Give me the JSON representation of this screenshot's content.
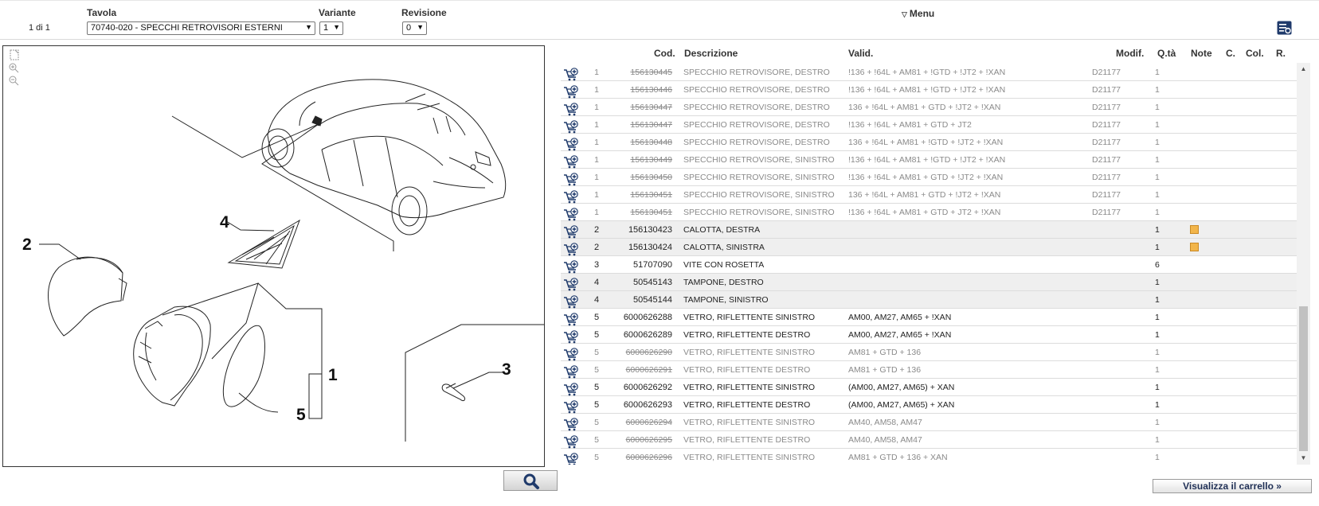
{
  "header": {
    "page_info": "1 di 1",
    "tavola_label": "Tavola",
    "tavola_value": "70740-020 - SPECCHI RETROVISORI ESTERNI",
    "variante_label": "Variante",
    "variante_value": "1",
    "revisione_label": "Revisione",
    "revisione_value": "0",
    "menu_label": "Menu"
  },
  "drawing": {
    "callouts": [
      "1",
      "2",
      "3",
      "4",
      "5"
    ]
  },
  "table": {
    "headers": {
      "cod": "Cod.",
      "descrizione": "Descrizione",
      "valid": "Valid.",
      "modif": "Modif.",
      "qta": "Q.tà",
      "note": "Note",
      "c": "C.",
      "col": "Col.",
      "r": "R."
    },
    "rows": [
      {
        "num": "1",
        "code": "156130445",
        "desc": "SPECCHIO RETROVISORE, DESTRO",
        "valid": "!136 + !64L + AM81 + !GTD + !JT2 + !XAN",
        "modif": "D21177",
        "qty": "1",
        "obsolete": true,
        "shaded": false,
        "note": false
      },
      {
        "num": "1",
        "code": "156130446",
        "desc": "SPECCHIO RETROVISORE, DESTRO",
        "valid": "!136 + !64L + AM81 + !GTD + !JT2 + !XAN",
        "modif": "D21177",
        "qty": "1",
        "obsolete": true,
        "shaded": false,
        "note": false
      },
      {
        "num": "1",
        "code": "156130447",
        "desc": "SPECCHIO RETROVISORE, DESTRO",
        "valid": "136 + !64L + AM81 + GTD + !JT2 + !XAN",
        "modif": "D21177",
        "qty": "1",
        "obsolete": true,
        "shaded": false,
        "note": false
      },
      {
        "num": "1",
        "code": "156130447",
        "desc": "SPECCHIO RETROVISORE, DESTRO",
        "valid": "!136 + !64L + AM81 + GTD + JT2",
        "modif": "D21177",
        "qty": "1",
        "obsolete": true,
        "shaded": false,
        "note": false
      },
      {
        "num": "1",
        "code": "156130448",
        "desc": "SPECCHIO RETROVISORE, DESTRO",
        "valid": "136 + !64L + AM81 + !GTD + !JT2 + !XAN",
        "modif": "D21177",
        "qty": "1",
        "obsolete": true,
        "shaded": false,
        "note": false
      },
      {
        "num": "1",
        "code": "156130449",
        "desc": "SPECCHIO RETROVISORE, SINISTRO",
        "valid": "!136 + !64L + AM81 + !GTD + !JT2 + !XAN",
        "modif": "D21177",
        "qty": "1",
        "obsolete": true,
        "shaded": false,
        "note": false
      },
      {
        "num": "1",
        "code": "156130450",
        "desc": "SPECCHIO RETROVISORE, SINISTRO",
        "valid": "!136 + !64L + AM81 + GTD + !JT2 + !XAN",
        "modif": "D21177",
        "qty": "1",
        "obsolete": true,
        "shaded": false,
        "note": false
      },
      {
        "num": "1",
        "code": "156130451",
        "desc": "SPECCHIO RETROVISORE, SINISTRO",
        "valid": "136 + !64L + AM81 + GTD + !JT2 + !XAN",
        "modif": "D21177",
        "qty": "1",
        "obsolete": true,
        "shaded": false,
        "note": false
      },
      {
        "num": "1",
        "code": "156130451",
        "desc": "SPECCHIO RETROVISORE, SINISTRO",
        "valid": "!136 + !64L + AM81 + GTD + JT2 + !XAN",
        "modif": "D21177",
        "qty": "1",
        "obsolete": true,
        "shaded": false,
        "note": false
      },
      {
        "num": "2",
        "code": "156130423",
        "desc": "CALOTTA, DESTRA",
        "valid": "",
        "modif": "",
        "qty": "1",
        "obsolete": false,
        "shaded": true,
        "note": true
      },
      {
        "num": "2",
        "code": "156130424",
        "desc": "CALOTTA, SINISTRA",
        "valid": "",
        "modif": "",
        "qty": "1",
        "obsolete": false,
        "shaded": true,
        "note": true
      },
      {
        "num": "3",
        "code": "51707090",
        "desc": "VITE CON ROSETTA",
        "valid": "",
        "modif": "",
        "qty": "6",
        "obsolete": false,
        "shaded": false,
        "note": false
      },
      {
        "num": "4",
        "code": "50545143",
        "desc": "TAMPONE, DESTRO",
        "valid": "",
        "modif": "",
        "qty": "1",
        "obsolete": false,
        "shaded": true,
        "note": false
      },
      {
        "num": "4",
        "code": "50545144",
        "desc": "TAMPONE, SINISTRO",
        "valid": "",
        "modif": "",
        "qty": "1",
        "obsolete": false,
        "shaded": true,
        "note": false
      },
      {
        "num": "5",
        "code": "6000626288",
        "desc": "VETRO, RIFLETTENTE SINISTRO",
        "valid": "AM00, AM27, AM65 + !XAN",
        "modif": "",
        "qty": "1",
        "obsolete": false,
        "shaded": false,
        "note": false
      },
      {
        "num": "5",
        "code": "6000626289",
        "desc": "VETRO, RIFLETTENTE DESTRO",
        "valid": "AM00, AM27, AM65 + !XAN",
        "modif": "",
        "qty": "1",
        "obsolete": false,
        "shaded": false,
        "note": false
      },
      {
        "num": "5",
        "code": "6000626290",
        "desc": "VETRO, RIFLETTENTE SINISTRO",
        "valid": "AM81 + GTD + 136",
        "modif": "",
        "qty": "1",
        "obsolete": true,
        "shaded": false,
        "note": false
      },
      {
        "num": "5",
        "code": "6000626291",
        "desc": "VETRO, RIFLETTENTE DESTRO",
        "valid": "AM81 + GTD + 136",
        "modif": "",
        "qty": "1",
        "obsolete": true,
        "shaded": false,
        "note": false
      },
      {
        "num": "5",
        "code": "6000626292",
        "desc": "VETRO, RIFLETTENTE SINISTRO",
        "valid": "(AM00, AM27, AM65) + XAN",
        "modif": "",
        "qty": "1",
        "obsolete": false,
        "shaded": false,
        "note": false
      },
      {
        "num": "5",
        "code": "6000626293",
        "desc": "VETRO, RIFLETTENTE DESTRO",
        "valid": "(AM00, AM27, AM65) + XAN",
        "modif": "",
        "qty": "1",
        "obsolete": false,
        "shaded": false,
        "note": false
      },
      {
        "num": "5",
        "code": "6000626294",
        "desc": "VETRO, RIFLETTENTE SINISTRO",
        "valid": "AM40, AM58, AM47",
        "modif": "",
        "qty": "1",
        "obsolete": true,
        "shaded": false,
        "note": false
      },
      {
        "num": "5",
        "code": "6000626295",
        "desc": "VETRO, RIFLETTENTE DESTRO",
        "valid": "AM40, AM58, AM47",
        "modif": "",
        "qty": "1",
        "obsolete": true,
        "shaded": false,
        "note": false
      },
      {
        "num": "5",
        "code": "6000626296",
        "desc": "VETRO, RIFLETTENTE SINISTRO",
        "valid": "AM81 + GTD + 136 + XAN",
        "modif": "",
        "qty": "1",
        "obsolete": true,
        "shaded": false,
        "note": false
      }
    ]
  },
  "footer": {
    "search_icon": "search-icon",
    "cart_button_label": "Visualizza il carrello »"
  },
  "colors": {
    "cart_icon": "#1f3a6b",
    "note_icon": "#f2b54a",
    "obsolete_text": "#8a8a8a"
  }
}
